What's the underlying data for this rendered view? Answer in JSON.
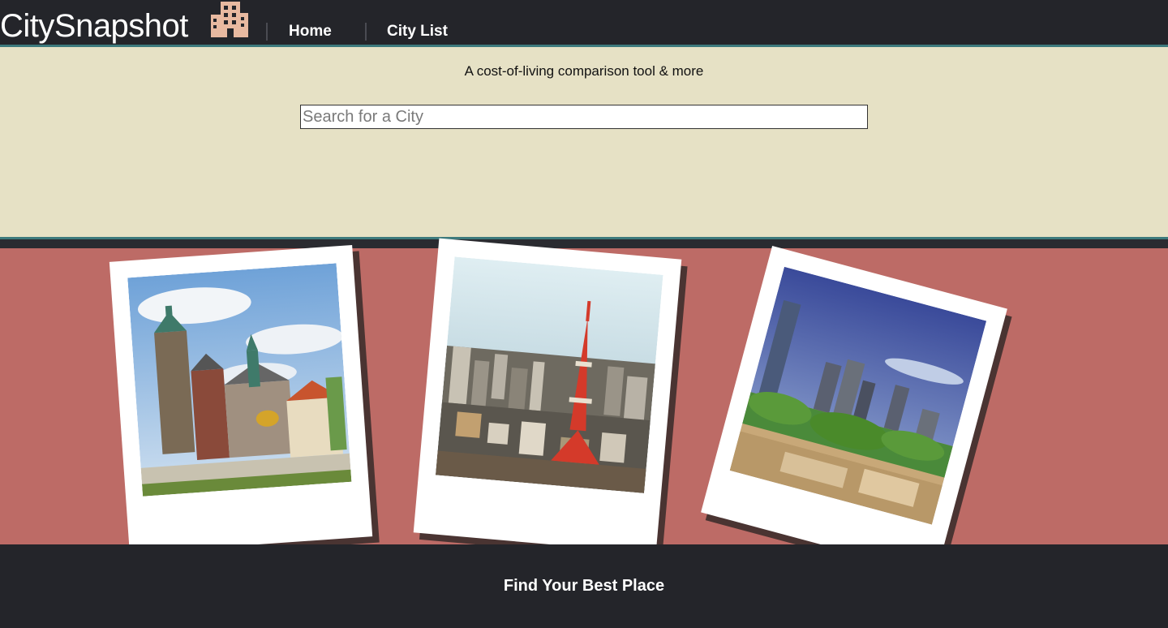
{
  "header": {
    "brand": "CitySnapshot",
    "brand_icon": "city-buildings-icon",
    "nav": [
      {
        "label": "Home"
      },
      {
        "label": "City List"
      }
    ]
  },
  "hero": {
    "tagline": "A cost-of-living comparison tool & more",
    "search_placeholder": "Search for a City"
  },
  "gallery": {
    "photos": [
      {
        "subject": "castle-cathedral-photo"
      },
      {
        "subject": "tower-skyline-photo"
      },
      {
        "subject": "city-skyline-photo"
      }
    ]
  },
  "footer": {
    "text": "Find Your Best Place"
  },
  "colors": {
    "header_bg": "#24252a",
    "accent_line": "#3d7a7d",
    "hero_bg": "#e6e1c5",
    "gallery_bg": "#bd6b66",
    "brand_icon": "#e8b9a0"
  }
}
